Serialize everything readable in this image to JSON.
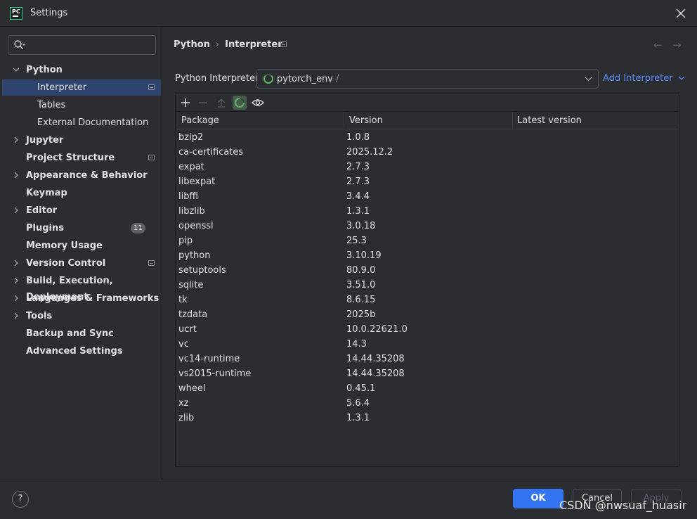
{
  "window": {
    "title": "Settings",
    "logo_text": "PC"
  },
  "sidebar": {
    "items": [
      {
        "label": "Python",
        "expanded": true
      },
      {
        "label": "Interpreter",
        "selected": true
      },
      {
        "label": "Tables"
      },
      {
        "label": "External Documentation"
      },
      {
        "label": "Jupyter"
      },
      {
        "label": "Project Structure"
      },
      {
        "label": "Appearance & Behavior"
      },
      {
        "label": "Keymap"
      },
      {
        "label": "Editor"
      },
      {
        "label": "Plugins",
        "badge": "11"
      },
      {
        "label": "Memory Usage"
      },
      {
        "label": "Version Control"
      },
      {
        "label": "Build, Execution, Deployment"
      },
      {
        "label": "Languages & Frameworks"
      },
      {
        "label": "Tools"
      },
      {
        "label": "Backup and Sync"
      },
      {
        "label": "Advanced Settings"
      }
    ]
  },
  "breadcrumb": {
    "parent": "Python",
    "current": "Interpreter",
    "separator": "›"
  },
  "nav": {
    "back": "←",
    "forward": "→"
  },
  "interpreter": {
    "label": "Python Interpreter:",
    "value": "pytorch_env",
    "suffix": "/",
    "add_label": "Add Interpreter"
  },
  "packages": {
    "columns": [
      "Package",
      "Version",
      "Latest version"
    ],
    "rows": [
      {
        "name": "bzip2",
        "version": "1.0.8",
        "latest": ""
      },
      {
        "name": "ca-certificates",
        "version": "2025.12.2",
        "latest": ""
      },
      {
        "name": "expat",
        "version": "2.7.3",
        "latest": ""
      },
      {
        "name": "libexpat",
        "version": "2.7.3",
        "latest": ""
      },
      {
        "name": "libffi",
        "version": "3.4.4",
        "latest": ""
      },
      {
        "name": "libzlib",
        "version": "1.3.1",
        "latest": ""
      },
      {
        "name": "openssl",
        "version": "3.0.18",
        "latest": ""
      },
      {
        "name": "pip",
        "version": "25.3",
        "latest": ""
      },
      {
        "name": "python",
        "version": "3.10.19",
        "latest": ""
      },
      {
        "name": "setuptools",
        "version": "80.9.0",
        "latest": ""
      },
      {
        "name": "sqlite",
        "version": "3.51.0",
        "latest": ""
      },
      {
        "name": "tk",
        "version": "8.6.15",
        "latest": ""
      },
      {
        "name": "tzdata",
        "version": "2025b",
        "latest": ""
      },
      {
        "name": "ucrt",
        "version": "10.0.22621.0",
        "latest": ""
      },
      {
        "name": "vc",
        "version": "14.3",
        "latest": ""
      },
      {
        "name": "vc14-runtime",
        "version": "14.44.35208",
        "latest": ""
      },
      {
        "name": "vs2015-runtime",
        "version": "14.44.35208",
        "latest": ""
      },
      {
        "name": "wheel",
        "version": "0.45.1",
        "latest": ""
      },
      {
        "name": "xz",
        "version": "5.6.4",
        "latest": ""
      },
      {
        "name": "zlib",
        "version": "1.3.1",
        "latest": ""
      }
    ]
  },
  "footer": {
    "help": "?",
    "ok": "OK",
    "cancel": "Cancel",
    "apply": "Apply"
  },
  "watermark": "CSDN @nwsuaf_huasir",
  "colors": {
    "accent": "#3574f0",
    "link": "#548af7",
    "selection": "#2e436e",
    "background": "#2b2d30"
  }
}
